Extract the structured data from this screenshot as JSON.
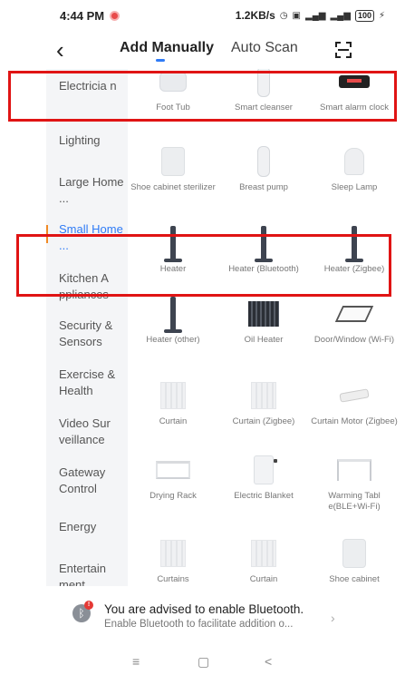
{
  "status_bar": {
    "time": "4:44 PM",
    "network_speed": "1.2KB/s",
    "battery": "100"
  },
  "header": {
    "back_icon": "chevron-left-icon",
    "tabs": [
      {
        "label": "Add Manually",
        "active": true
      },
      {
        "label": "Auto Scan",
        "active": false
      }
    ],
    "scan_icon": "scan-icon",
    "accent_color": "#2f7bf6"
  },
  "sidebar": {
    "items": [
      {
        "label": "Electricia n"
      },
      {
        "label": "Lighting"
      },
      {
        "label": "Large Home ..."
      },
      {
        "label": "Small Home ...",
        "active": true
      },
      {
        "label": "Kitchen A ppliances"
      },
      {
        "label": "Security & Sensors"
      },
      {
        "label": "Exercise & Health"
      },
      {
        "label": "Video Sur veillance"
      },
      {
        "label": "Gateway Control"
      },
      {
        "label": "Energy"
      },
      {
        "label": "Entertain ment"
      }
    ]
  },
  "devices": [
    {
      "label": "Foot Tub",
      "icon": "foot-tub"
    },
    {
      "label": "Smart cleanser",
      "icon": "cleanser"
    },
    {
      "label": "Smart alarm clock",
      "icon": "alarm-clock"
    },
    {
      "label": "",
      "icon": "cabinet"
    },
    {
      "label": "",
      "icon": "pump"
    },
    {
      "label": "",
      "icon": "lamp"
    },
    {
      "label": "Shoe cabinet sterilizer",
      "icon": "cabinet"
    },
    {
      "label": "Breast pump",
      "icon": "pump"
    },
    {
      "label": "Sleep Lamp",
      "icon": "lamp"
    },
    {
      "label": "Heater",
      "icon": "heater"
    },
    {
      "label": "Heater (Bluetooth)",
      "icon": "heater"
    },
    {
      "label": "Heater (Zigbee)",
      "icon": "heater"
    },
    {
      "label": "Heater (other)",
      "icon": "heater"
    },
    {
      "label": "Oil Heater",
      "icon": "oil-heater"
    },
    {
      "label": "Door/Window (Wi-Fi)",
      "icon": "door-window"
    },
    {
      "label": "Curtain",
      "icon": "curtain"
    },
    {
      "label": "Curtain (Zigbee)",
      "icon": "curtain"
    },
    {
      "label": "Curtain Motor (Zigbee)",
      "icon": "curtain-motor"
    },
    {
      "label": "Drying Rack",
      "icon": "drying-rack"
    },
    {
      "label": "Electric Blanket",
      "icon": "blanket"
    },
    {
      "label": "Warming Tabl e(BLE+Wi-Fi)",
      "icon": "warming-table"
    },
    {
      "label": "Curtains",
      "icon": "curtain"
    },
    {
      "label": "Curtain",
      "icon": "curtain"
    },
    {
      "label": "Shoe cabinet",
      "icon": "cabinet"
    }
  ],
  "banner": {
    "title": "You are advised to enable Bluetooth.",
    "subtitle": "Enable Bluetooth to facilitate addition o...",
    "badge": "!",
    "icon": "bluetooth-icon"
  },
  "system_nav": {
    "menu": "≡",
    "home": "▢",
    "back": "<"
  }
}
